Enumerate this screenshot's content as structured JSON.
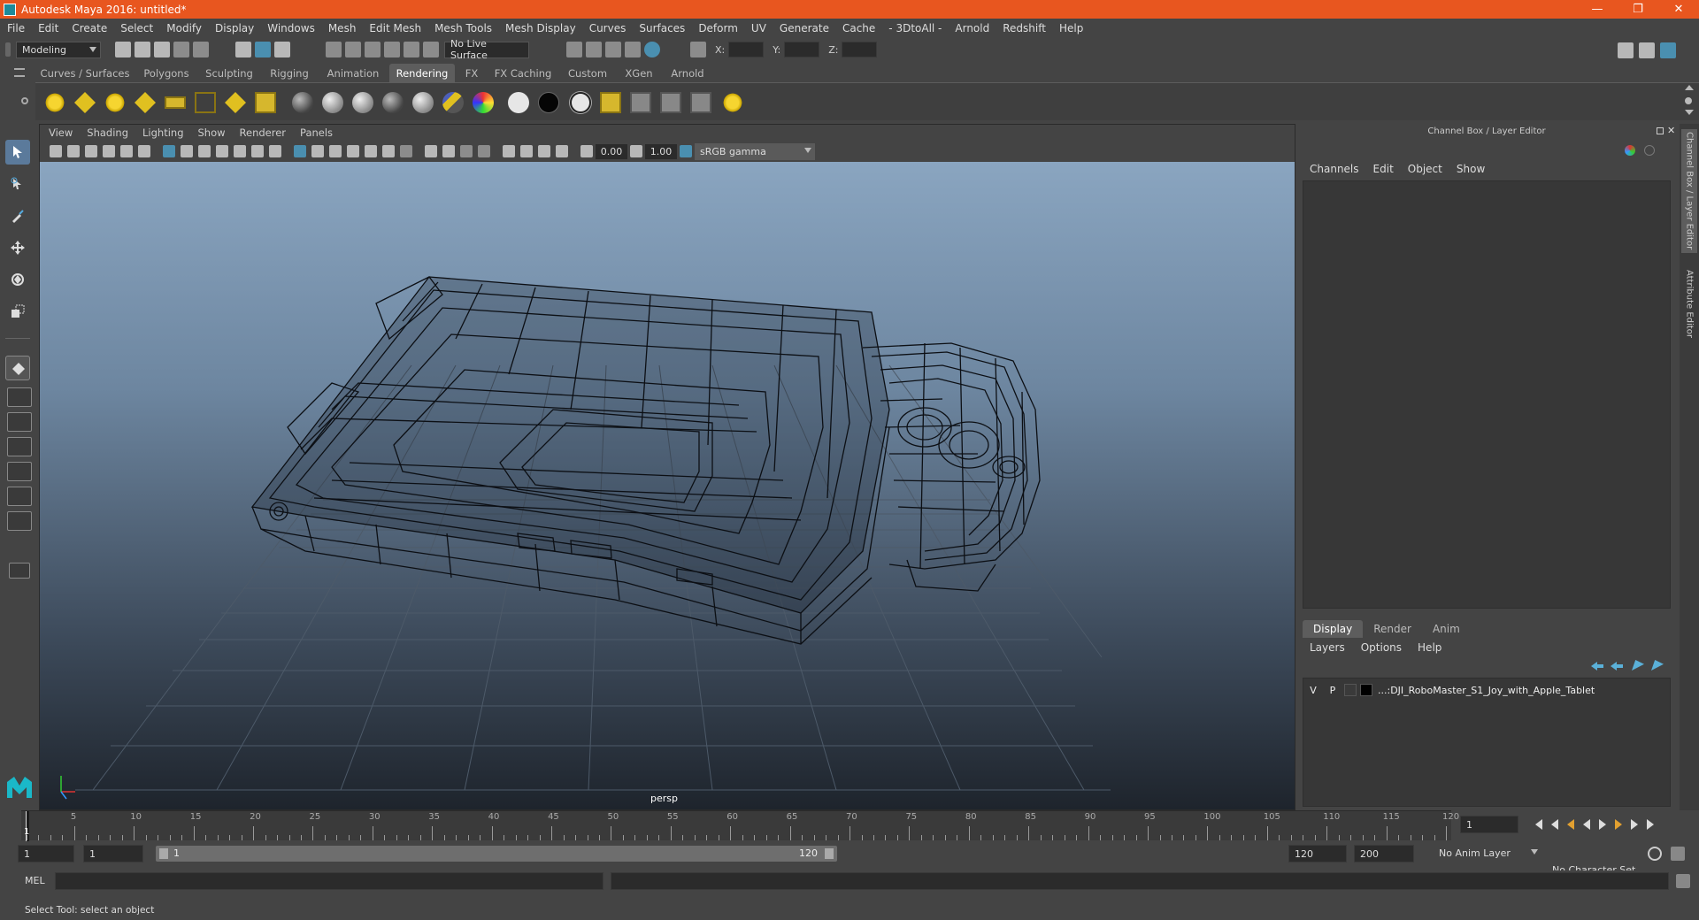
{
  "window": {
    "title": "Autodesk Maya 2016: untitled*"
  },
  "menu": [
    "File",
    "Edit",
    "Create",
    "Select",
    "Modify",
    "Display",
    "Windows",
    "Mesh",
    "Edit Mesh",
    "Mesh Tools",
    "Mesh Display",
    "Curves",
    "Surfaces",
    "Deform",
    "UV",
    "Generate",
    "Cache",
    "- 3DtoAll -",
    "Arnold",
    "Redshift",
    "Help"
  ],
  "status": {
    "mode": "Modeling",
    "live_surface": "No Live Surface",
    "x_label": "X:",
    "y_label": "Y:",
    "z_label": "Z:"
  },
  "shelf": {
    "tabs": [
      "Curves / Surfaces",
      "Polygons",
      "Sculpting",
      "Rigging",
      "Animation",
      "Rendering",
      "FX",
      "FX Caching",
      "Custom",
      "XGen",
      "Arnold"
    ],
    "active_tab": "Rendering"
  },
  "viewport": {
    "menu": [
      "View",
      "Shading",
      "Lighting",
      "Show",
      "Renderer",
      "Panels"
    ],
    "exposure": "0.00",
    "gamma": "1.00",
    "color_space": "sRGB gamma",
    "camera": "persp"
  },
  "channel_box": {
    "header": "Channel Box / Layer Editor",
    "menu": [
      "Channels",
      "Edit",
      "Object",
      "Show"
    ]
  },
  "layer_editor": {
    "tabs": [
      "Display",
      "Render",
      "Anim"
    ],
    "active_tab": "Display",
    "menu": [
      "Layers",
      "Options",
      "Help"
    ],
    "layer": {
      "v": "V",
      "p": "P",
      "name": "...:DJI_RoboMaster_S1_Joy_with_Apple_Tablet"
    }
  },
  "side_tabs": [
    "Channel Box / Layer Editor",
    "Attribute Editor"
  ],
  "timeline": {
    "labels": [
      "5",
      "10",
      "15",
      "20",
      "25",
      "30",
      "35",
      "40",
      "45",
      "50",
      "55",
      "60",
      "65",
      "70",
      "75",
      "80",
      "85",
      "90",
      "95",
      "100",
      "105",
      "110",
      "115",
      "120"
    ],
    "start_label": "1",
    "current_frame": "1"
  },
  "range": {
    "start": "1",
    "playback_start": "1",
    "slider_start": "1",
    "slider_end": "120",
    "playback_end": "120",
    "end": "200",
    "anim_layer": "No Anim Layer",
    "character_set": "No Character Set"
  },
  "command": {
    "label": "MEL"
  },
  "help_line": "Select Tool: select an object",
  "colors": {
    "title_bar": "#e8561f",
    "active_tool": "#5b7a9b",
    "background": "#444444"
  }
}
